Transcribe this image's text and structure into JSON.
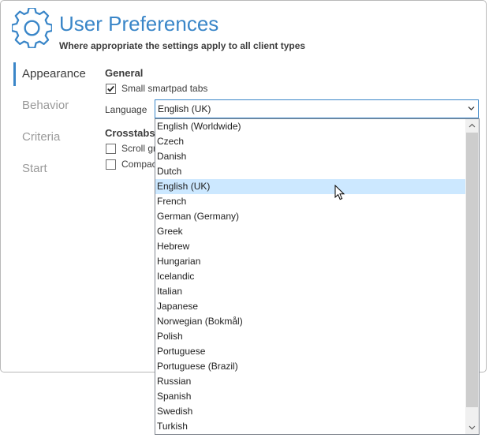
{
  "header": {
    "title": "User Preferences",
    "subtitle": "Where appropriate the settings apply to all client types",
    "icon": "gear-icon"
  },
  "nav": {
    "items": [
      {
        "label": "Appearance",
        "active": true
      },
      {
        "label": "Behavior",
        "active": false
      },
      {
        "label": "Criteria",
        "active": false
      },
      {
        "label": "Start",
        "active": false
      }
    ]
  },
  "general": {
    "heading": "General",
    "small_tabs": {
      "label": "Small smartpad tabs",
      "checked": true
    },
    "language_label": "Language",
    "language_value": "English (UK)"
  },
  "crosstabs": {
    "heading": "Crosstabs",
    "scroll_label": "Scroll gr",
    "compact_label": "Compac"
  },
  "dropdown": {
    "selected_index": 4,
    "options": [
      "English (Worldwide)",
      "Czech",
      "Danish",
      "Dutch",
      "English (UK)",
      "French",
      "German (Germany)",
      "Greek",
      "Hebrew",
      "Hungarian",
      "Icelandic",
      "Italian",
      "Japanese",
      "Norwegian (Bokmål)",
      "Polish",
      "Portuguese",
      "Portuguese (Brazil)",
      "Russian",
      "Spanish",
      "Swedish",
      "Turkish"
    ]
  },
  "colors": {
    "accent": "#3a86c8",
    "selection": "#cce8ff"
  }
}
